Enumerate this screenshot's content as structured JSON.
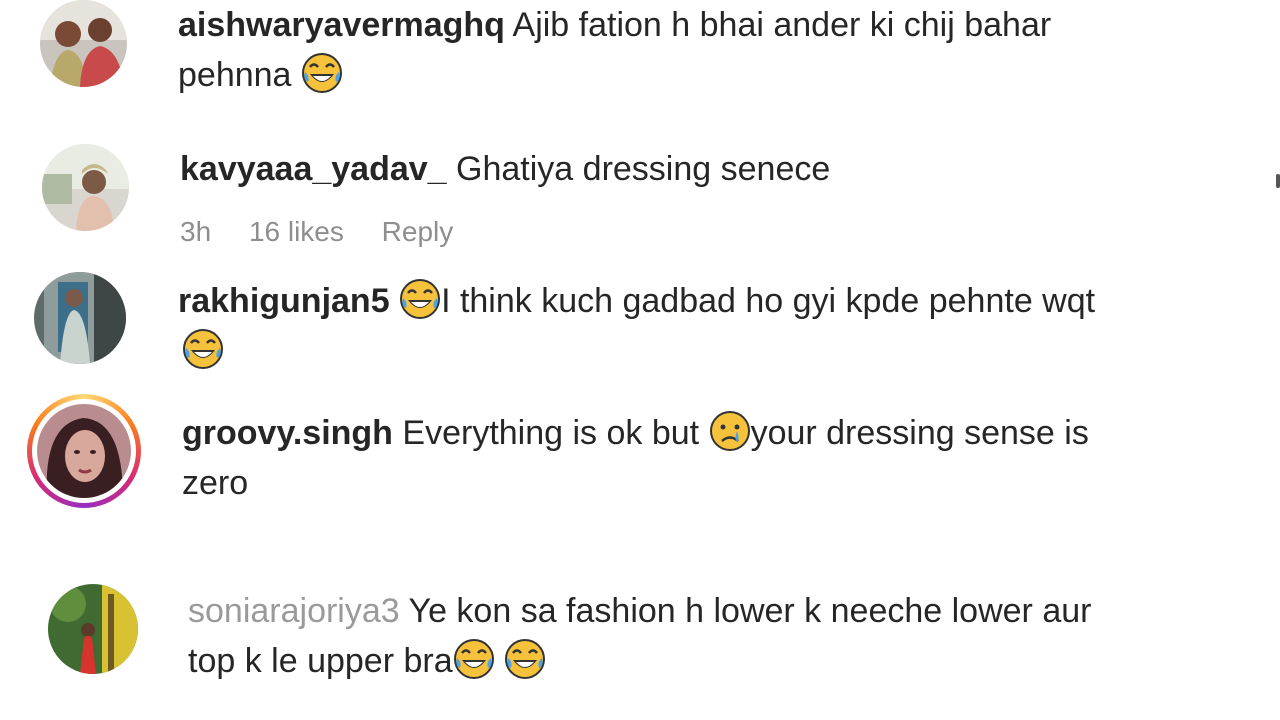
{
  "comments": [
    {
      "username": "aishwaryavermaghq",
      "line1": "Ajib fation h bhai ander ki chij bahar",
      "line2": "pehnna",
      "emoji": "face-with-tears-of-joy"
    },
    {
      "username": "kavyaaa_yadav_",
      "line1": "Ghatiya dressing senece",
      "meta": {
        "time": "3h",
        "likes": "16 likes",
        "reply": "Reply"
      }
    },
    {
      "username": "rakhigunjan5",
      "line1": "I think kuch gadbad ho gyi kpde pehnte wqt",
      "emoji": "face-with-tears-of-joy"
    },
    {
      "username": "groovy.singh",
      "line1a": "Everything is ok but",
      "line1b": "your dressing sense is",
      "line2": "zero",
      "emoji": "crying-face"
    },
    {
      "username": "soniarajoriya3",
      "line1": "Ye kon sa fashion h lower k neeche lower aur",
      "line2": "top k le upper bra",
      "emoji": "face-with-tears-of-joy"
    }
  ],
  "colors": {
    "text": "#262626",
    "muted": "#8e8e8e",
    "emoji_yellow": "#f7c23b",
    "story_ring": [
      "#feda75",
      "#fa7e1e",
      "#d62976",
      "#962fbf"
    ]
  }
}
